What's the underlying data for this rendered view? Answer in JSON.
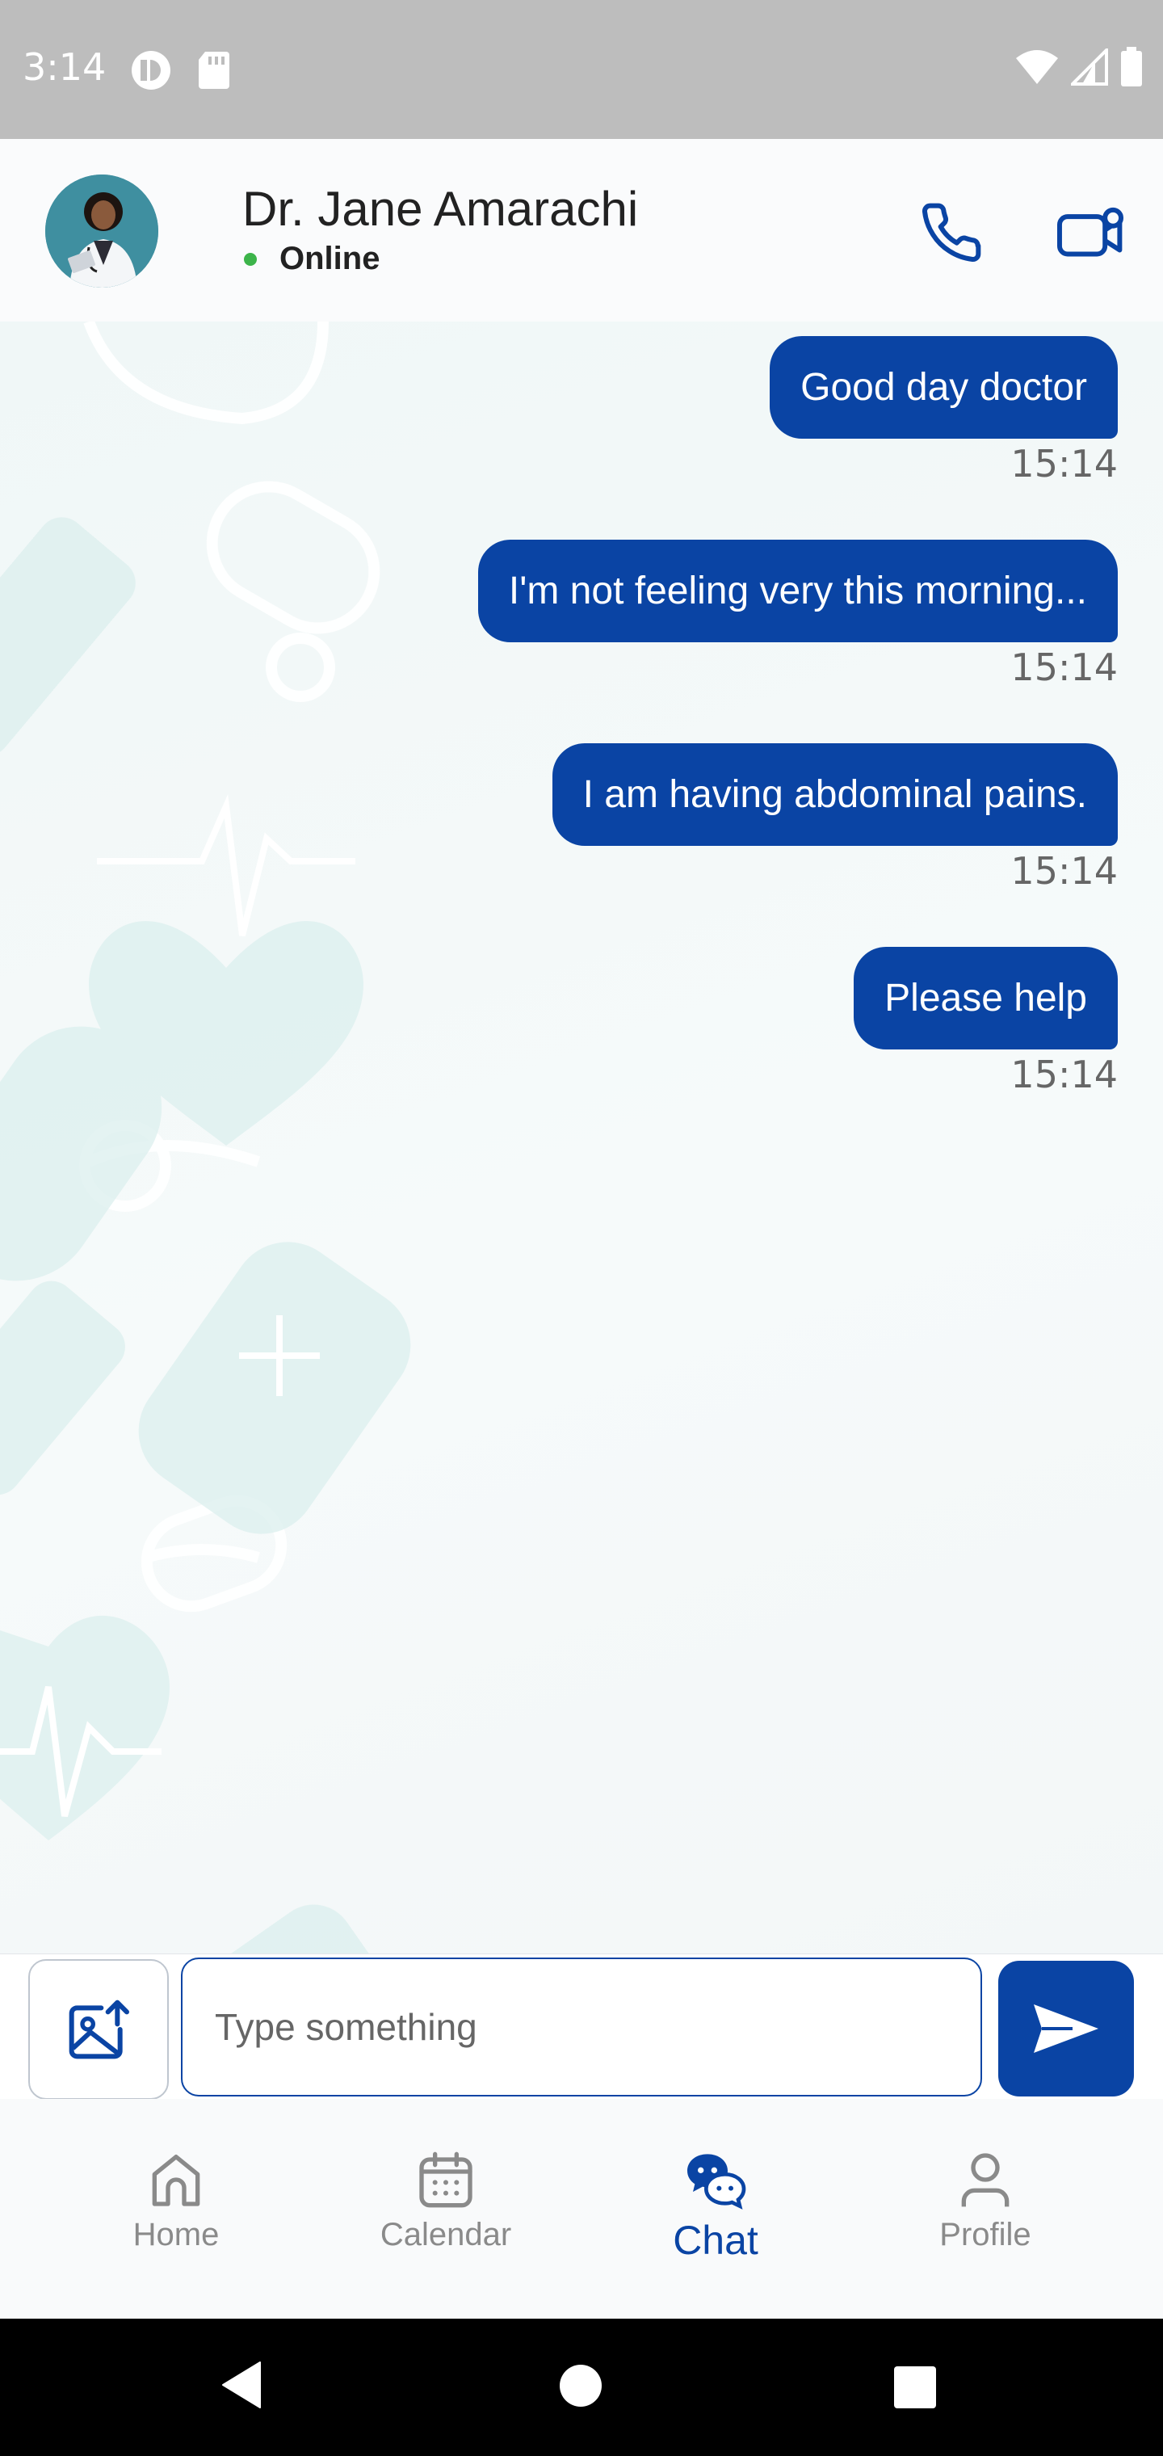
{
  "status_bar": {
    "time": "3:14"
  },
  "header": {
    "doctor_name": "Dr. Jane Amarachi",
    "status": "Online"
  },
  "messages": [
    {
      "text": "Good day doctor",
      "time": "15:14"
    },
    {
      "text": "I'm not feeling very this morning...",
      "time": "15:14"
    },
    {
      "text": "I am having abdominal pains.",
      "time": "15:14"
    },
    {
      "text": "Please help",
      "time": "15:14"
    }
  ],
  "composer": {
    "placeholder": "Type something"
  },
  "nav": {
    "home": "Home",
    "calendar": "Calendar",
    "chat": "Chat",
    "profile": "Profile",
    "active": "Chat"
  },
  "colors": {
    "primary": "#0a44a4",
    "online": "#3cb44a",
    "background": "#f5f8f9"
  }
}
